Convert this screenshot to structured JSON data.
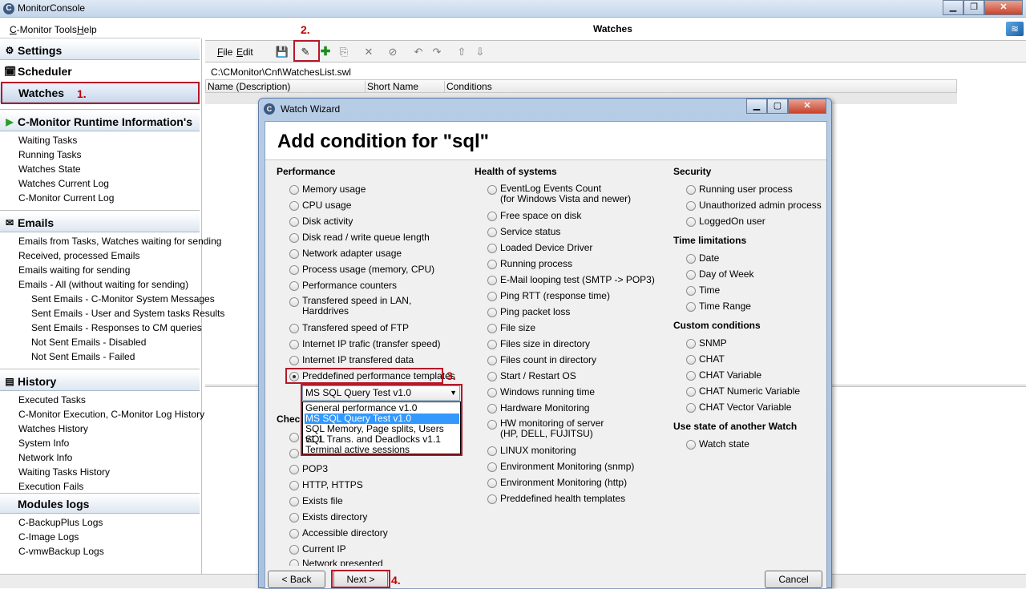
{
  "window": {
    "title": "MonitorConsole",
    "min_icon": "minimize-icon",
    "max_icon": "maximize-icon",
    "close_icon": "close-icon"
  },
  "menubar": {
    "items": [
      "C-Monitor Tools",
      "Help"
    ]
  },
  "sidebar": {
    "settings": "Settings",
    "scheduler": "Scheduler",
    "watches": "Watches",
    "runtime": {
      "title": "C-Monitor Runtime Information's",
      "items": [
        "Waiting Tasks",
        "Running Tasks",
        "Watches State",
        "Watches Current Log",
        "C-Monitor Current Log"
      ]
    },
    "emails": {
      "title": "Emails",
      "items": [
        "Emails from Tasks, Watches waiting for sending",
        "Received, processed Emails",
        "Emails waiting for sending",
        "Emails - All (without waiting for sending)"
      ],
      "subitems": [
        "Sent Emails - C-Monitor System Messages",
        "Sent Emails - User and System tasks Results",
        "Sent Emails - Responses to CM queries",
        "Not Sent Emails - Disabled",
        "Not Sent Emails - Failed"
      ]
    },
    "history": {
      "title": "History",
      "items": [
        "Executed Tasks",
        "C-Monitor Execution, C-Monitor Log History",
        "Watches History",
        "System Info",
        "Network Info",
        "Waiting Tasks History",
        "Execution Fails"
      ]
    },
    "modules": {
      "title": "Modules logs",
      "items": [
        "C-BackupPlus Logs",
        "C-Image Logs",
        "C-vmwBackup Logs"
      ]
    }
  },
  "main": {
    "title": "Watches",
    "file_menu": "File",
    "edit_menu": "Edit",
    "path": "C:\\CMonitor\\Cnf\\WatchesList.swl",
    "columns": [
      "Name (Description)",
      "Short Name",
      "Conditions"
    ]
  },
  "annotations": {
    "step1": "1.",
    "step2": "2.",
    "step3": "3.",
    "step4": "4.",
    "color": "#b5182a"
  },
  "dialog": {
    "title": "Watch Wizard",
    "heading": "Add condition for \"sql\"",
    "performance": {
      "title": "Performance",
      "options": [
        "Memory usage",
        "CPU usage",
        "Disk activity",
        "Disk read / write queue length",
        "Network adapter usage",
        "Process usage (memory, CPU)",
        "Performance counters",
        "Transfered speed in LAN,",
        "Transfered speed of FTP",
        "Internet IP trafic (transfer speed)",
        "Internet IP transfered data",
        "Preddefined performance templates"
      ],
      "option_line2": "Harddrives",
      "selected": "Preddefined performance templates"
    },
    "check": {
      "title_visible": "Chec",
      "options": [
        "",
        "",
        "POP3",
        "HTTP, HTTPS",
        "Exists file",
        "Exists directory",
        "Accessible directory",
        "Current IP",
        "Network presented"
      ]
    },
    "combo": {
      "value": "MS SQL Query Test v1.0",
      "options": [
        "General performance v1.0",
        "MS SQL Query Test v1.0",
        "SQL Memory, Page splits, Users v1.1",
        "SQL Trans. and Deadlocks v1.1",
        "Terminal active sessions"
      ]
    },
    "health": {
      "title": "Health of systems",
      "options": [
        "EventLog Events Count",
        "Free space on disk",
        "Service status",
        "Loaded Device Driver",
        "Running process",
        "E-Mail looping test (SMTP -> POP3)",
        "Ping RTT (response time)",
        "Ping packet loss",
        "File size",
        "Files size in directory",
        "Files count in directory",
        "Start / Restart OS",
        "Windows running time",
        "Hardware Monitoring",
        "HW monitoring of server",
        "LINUX monitoring",
        "Environment Monitoring (snmp)",
        "Environment Monitoring (http)",
        "Preddefined health templates"
      ],
      "eventlog_line2": "(for Windows Vista and newer)",
      "hw_line2": "(HP, DELL, FUJITSU)"
    },
    "security": {
      "title": "Security",
      "options": [
        "Running user process",
        "Unauthorized admin process",
        "LoggedOn user"
      ]
    },
    "time": {
      "title": "Time limitations",
      "options": [
        "Date",
        "Day of Week",
        "Time",
        "Time Range"
      ]
    },
    "custom": {
      "title": "Custom conditions",
      "options": [
        "SNMP",
        "CHAT",
        "CHAT Variable",
        "CHAT Numeric Variable",
        "CHAT Vector Variable"
      ]
    },
    "another": {
      "title": "Use state of another Watch",
      "options": [
        "Watch state"
      ]
    },
    "buttons": {
      "back": "< Back",
      "next": "Next >",
      "cancel": "Cancel"
    }
  }
}
